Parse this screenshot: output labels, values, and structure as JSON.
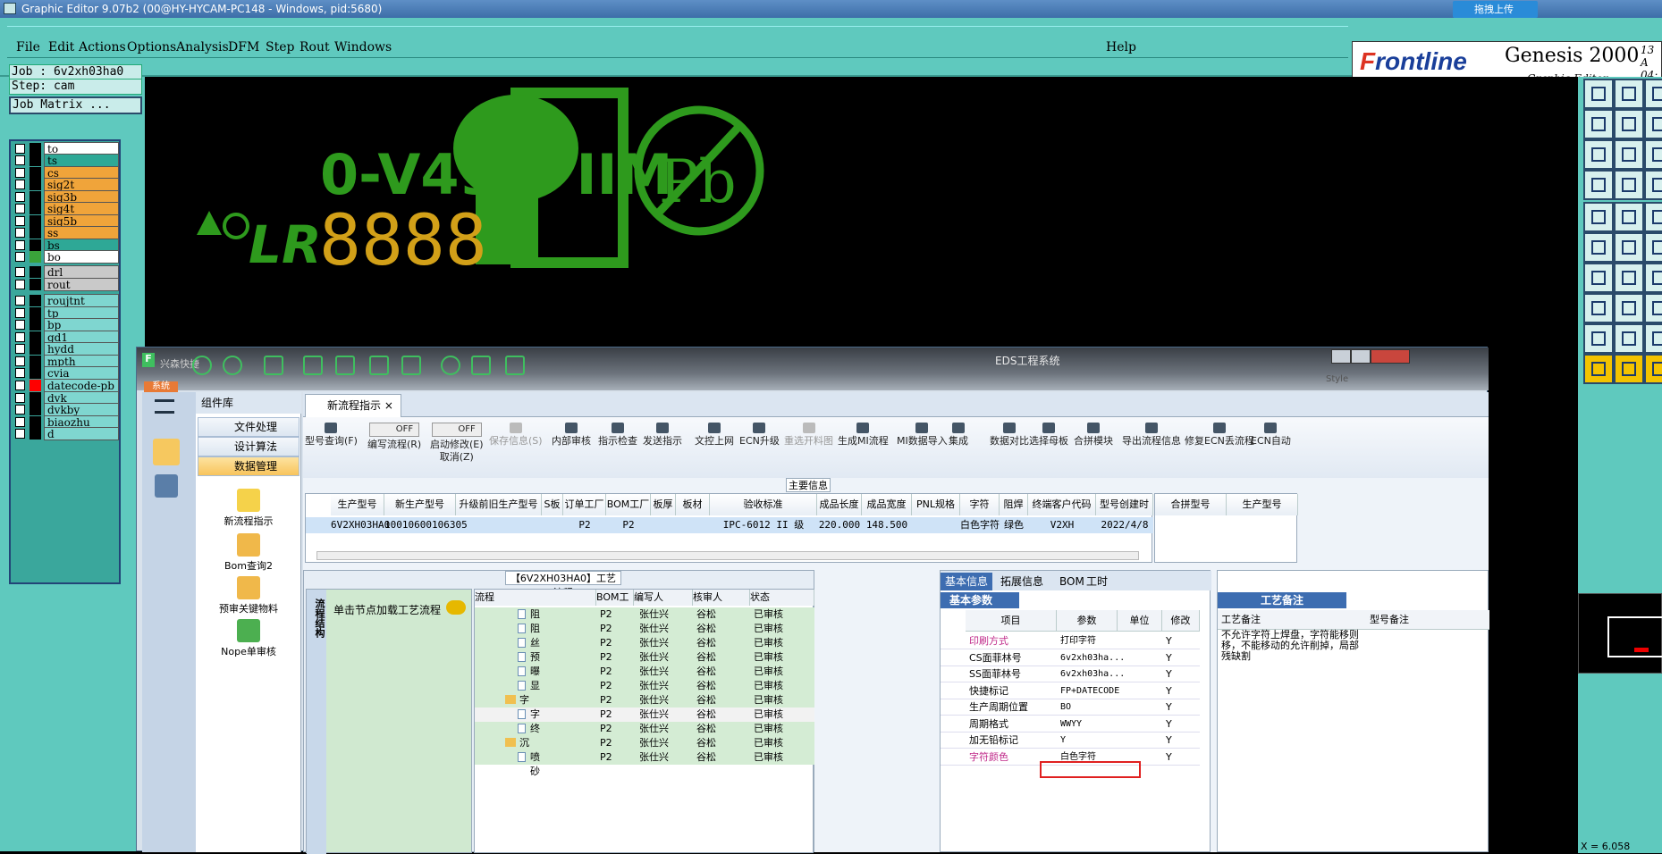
{
  "window": {
    "title": "Graphic Editor 9.07b2 (00@HY-HYCAM-PC148 - Windows, pid:5680)",
    "upload": "拖拽上传"
  },
  "menu": [
    "File",
    "Edit",
    "Actions",
    "Options",
    "Analysis",
    "DFM",
    "Step",
    "Rout",
    "Windows"
  ],
  "help": "Help",
  "brand": {
    "logo_a": "F",
    "logo_b": "rontline",
    "product": "Genesis 2000",
    "sub": "Graphic Editor",
    "date1": "13 A",
    "date2": "04:"
  },
  "job": {
    "job": "Job : 6v2xh03ha0",
    "step": "Step: cam",
    "matrix": "Job Matrix ..."
  },
  "layers": [
    {
      "name": "to",
      "color": "#ffffff",
      "swatch": "#000000",
      "dot": true
    },
    {
      "name": "ts",
      "color": "#2ea896",
      "swatch": "#000000",
      "dot": false
    },
    {
      "name": "cs",
      "color": "#f0a43a",
      "swatch": "#000000",
      "dot": true
    },
    {
      "name": "sig2t",
      "color": "#f0a43a",
      "swatch": "#000000",
      "dot": true
    },
    {
      "name": "sig3b",
      "color": "#f0a43a",
      "swatch": "#000000",
      "dot": true
    },
    {
      "name": "sig4t",
      "color": "#f0a43a",
      "swatch": "#000000",
      "dot": true
    },
    {
      "name": "sig5b",
      "color": "#f0a43a",
      "swatch": "#000000",
      "dot": true
    },
    {
      "name": "ss",
      "color": "#f0a43a",
      "swatch": "#000000",
      "dot": true
    },
    {
      "name": "bs",
      "color": "#2ea896",
      "swatch": "#000000",
      "dot": false
    },
    {
      "name": "bo",
      "color": "#ffffff",
      "swatch": "#3aa33a",
      "dot": true
    },
    {
      "name": "drl",
      "color": "#c9c9c9",
      "swatch": "#000000",
      "dot": false
    },
    {
      "name": "rout",
      "color": "#c9c9c9",
      "swatch": "#000000",
      "dot": false
    },
    {
      "name": "roujtnt",
      "color": "#7fd6d0",
      "swatch": "#000000",
      "dot": false
    },
    {
      "name": "tp",
      "color": "#7fd6d0",
      "swatch": "#000000",
      "dot": false
    },
    {
      "name": "bp",
      "color": "#7fd6d0",
      "swatch": "#000000",
      "dot": false
    },
    {
      "name": "gd1",
      "color": "#7fd6d0",
      "swatch": "#000000",
      "dot": false
    },
    {
      "name": "hydd",
      "color": "#7fd6d0",
      "swatch": "#000000",
      "dot": false
    },
    {
      "name": "mpth",
      "color": "#7fd6d0",
      "swatch": "#000000",
      "dot": false
    },
    {
      "name": "cvia",
      "color": "#7fd6d0",
      "swatch": "#000000",
      "dot": false
    },
    {
      "name": "datecode-pb",
      "color": "#7fd6d0",
      "swatch": "#ff0000",
      "dot": false
    },
    {
      "name": "dvk",
      "color": "#7fd6d0",
      "swatch": "#000000",
      "dot": false
    },
    {
      "name": "dvkby",
      "color": "#7fd6d0",
      "swatch": "#000000",
      "dot": false
    },
    {
      "name": "biaozhu",
      "color": "#7fd6d0",
      "swatch": "#000000",
      "dot": false
    },
    {
      "name": "d",
      "color": "#7fd6d0",
      "swatch": "#000000",
      "dot": false
    }
  ],
  "canvas": {
    "text1": "0-V49 S IIM",
    "digits": "8888",
    "pb": "Pb",
    "ul": "LR",
    "r": "R"
  },
  "coord": "X = 6.058",
  "eds": {
    "title": "EDS工程系统",
    "sys_tab": "系统",
    "quick": "兴森快捷",
    "style": "Style",
    "nav_header": "组件库",
    "tree": [
      "文件处理",
      "设计算法",
      "数据管理"
    ],
    "nav": [
      "新流程指示",
      "Bom查询2",
      "预审关键物料",
      "Nope单审核"
    ],
    "tab": "新流程指示",
    "toolbar": [
      "型号查询(F)",
      "编写流程(R)",
      "启动修改(E)",
      "保存信息(S)",
      "内部审核",
      "指示检查",
      "发送指示",
      "文控上网",
      "ECN升级",
      "重选开料图",
      "生成MI流程",
      "MI数据导入",
      "集成",
      "数据对比",
      "选择母板",
      "合拼模块",
      "导出流程信息",
      "修复ECN丢流程",
      "ECN自动"
    ],
    "cancel": "取消(Z)",
    "off": "OFF",
    "main_info": "主要信息",
    "cols": [
      "生产型号",
      "新生产型号",
      "升级前旧生产型号",
      "S板",
      "订单工厂",
      "BOM工厂",
      "板厚",
      "板材",
      "验收标准",
      "成品长度",
      "成品宽度",
      "PNL规格",
      "字符",
      "阻焊",
      "终端客户代码",
      "型号创建时"
    ],
    "row": [
      "6V2XH03HA0",
      "10010600106305",
      "",
      "",
      "P2",
      "P2",
      "",
      "",
      "IPC-6012 II 级",
      "220.000",
      "148.500",
      "",
      "白色字符",
      "绿色",
      "V2XH",
      "2022/4/8"
    ],
    "cols2": [
      "合拼型号",
      "生产型号"
    ],
    "proc_title": "【6V2XH03HA0】工艺流程",
    "proc_vtab": "流程结构",
    "proc_hint": "单击节点加载工艺流程",
    "proc_cols": [
      "流程",
      "BOM工厂",
      "编写人",
      "核审人",
      "状态"
    ],
    "proc_rows": [
      {
        "name": "阻焊前处理",
        "bom": "P2",
        "w": "张仕兴",
        "r": "谷松",
        "s": "已审核",
        "type": "doc"
      },
      {
        "name": "阻焊塞孔",
        "bom": "P2",
        "w": "张仕兴",
        "r": "谷松",
        "s": "已审核",
        "type": "doc"
      },
      {
        "name": "丝印",
        "bom": "P2",
        "w": "张仕兴",
        "r": "谷松",
        "s": "已审核",
        "type": "doc"
      },
      {
        "name": "预烘",
        "bom": "P2",
        "w": "张仕兴",
        "r": "谷松",
        "s": "已审核",
        "type": "doc"
      },
      {
        "name": "曝光",
        "bom": "P2",
        "w": "张仕兴",
        "r": "谷松",
        "s": "已审核",
        "type": "doc"
      },
      {
        "name": "显影",
        "bom": "P2",
        "w": "张仕兴",
        "r": "谷松",
        "s": "已审核",
        "type": "doc"
      },
      {
        "name": "字符",
        "bom": "P2",
        "w": "张仕兴",
        "r": "谷松",
        "s": "已审核",
        "type": "folder"
      },
      {
        "name": "字符",
        "bom": "P2",
        "w": "张仕兴",
        "r": "谷松",
        "s": "已审核",
        "type": "doc"
      },
      {
        "name": "终固化",
        "bom": "P2",
        "w": "张仕兴",
        "r": "谷松",
        "s": "已审核",
        "type": "doc"
      },
      {
        "name": "沉金",
        "bom": "P2",
        "w": "张仕兴",
        "r": "谷松",
        "s": "已审核",
        "type": "folder"
      },
      {
        "name": "喷砂",
        "bom": "P2",
        "w": "张仕兴",
        "r": "谷松",
        "s": "已审核",
        "type": "doc"
      }
    ],
    "basic_tabs": [
      "基本信息",
      "拓展信息",
      "BOM",
      "工时"
    ],
    "basic_hdr": "基本参数",
    "basic_cols": [
      "项目",
      "参数",
      "单位",
      "修改"
    ],
    "basic_rows": [
      {
        "k": "印刷方式",
        "v": "打印字符",
        "m": "Y",
        "pink": true
      },
      {
        "k": "CS面菲林号",
        "v": "6v2xh03ha...",
        "m": "Y",
        "pink": false
      },
      {
        "k": "SS面菲林号",
        "v": "6v2xh03ha...",
        "m": "Y",
        "pink": false
      },
      {
        "k": "快捷标记",
        "v": "FP+DATECODE",
        "m": "Y",
        "pink": false
      },
      {
        "k": "生产周期位置",
        "v": "BO",
        "m": "Y",
        "pink": false
      },
      {
        "k": "周期格式",
        "v": "WWYY",
        "m": "Y",
        "pink": false
      },
      {
        "k": "加无铅标记",
        "v": "Y",
        "m": "Y",
        "pink": false
      },
      {
        "k": "字符颜色",
        "v": "白色字符",
        "m": "Y",
        "pink": true
      }
    ],
    "remarks_hdr": "工艺备注",
    "remarks_cols": [
      "工艺备注",
      "型号备注"
    ],
    "remarks_text": "不允许字符上焊盘，字符能移则移，不能移动的允许削掉，局部残缺割"
  }
}
